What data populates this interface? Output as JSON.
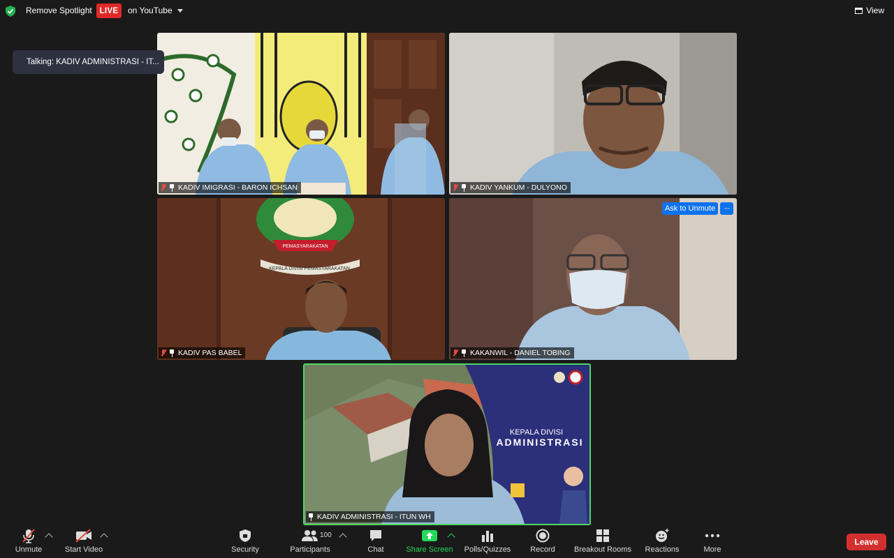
{
  "top": {
    "remove_spotlight": "Remove Spotlight",
    "live_badge": "LIVE",
    "live_target": "on YouTube",
    "view_label": "View"
  },
  "talking_indicator": "Talking: KADIV ADMINISTRASI - IT...",
  "tiles": [
    {
      "name": "KADIV IMIGRASI - BARON ICHSAN",
      "muted": true
    },
    {
      "name": "KADIV YANKUM - DULYONO",
      "muted": true
    },
    {
      "name": "KADIV PAS BABEL",
      "muted": true
    },
    {
      "name": "KAKANWIL - DANIEL TOBING",
      "muted": true
    },
    {
      "name": "KADIV ADMINISTRASI - ITUN WH",
      "muted": false,
      "active_speaker": true
    }
  ],
  "tile4_actions": {
    "ask_to_unmute": "Ask to Unmute",
    "more": "···"
  },
  "tile5_banner": {
    "line1": "KEPALA DIVISI",
    "line2": "ADMINISTRASI"
  },
  "tile3_plaque": {
    "top": "PEMASYARAKATAN",
    "bottom": "KEPALA DIVISI PEMASYARAKATAN"
  },
  "toolbar": {
    "unmute": "Unmute",
    "start_video": "Start Video",
    "security": "Security",
    "participants": "Participants",
    "participants_count": "100",
    "chat": "Chat",
    "share_screen": "Share Screen",
    "polls": "Polls/Quizzes",
    "record": "Record",
    "breakout": "Breakout Rooms",
    "reactions": "Reactions",
    "more": "More",
    "leave": "Leave"
  },
  "colors": {
    "accent_blue": "#0e72ed",
    "live_red": "#e02828",
    "leave_red": "#d42f2f",
    "share_green": "#23d959",
    "speaker_border": "#4cd964"
  }
}
